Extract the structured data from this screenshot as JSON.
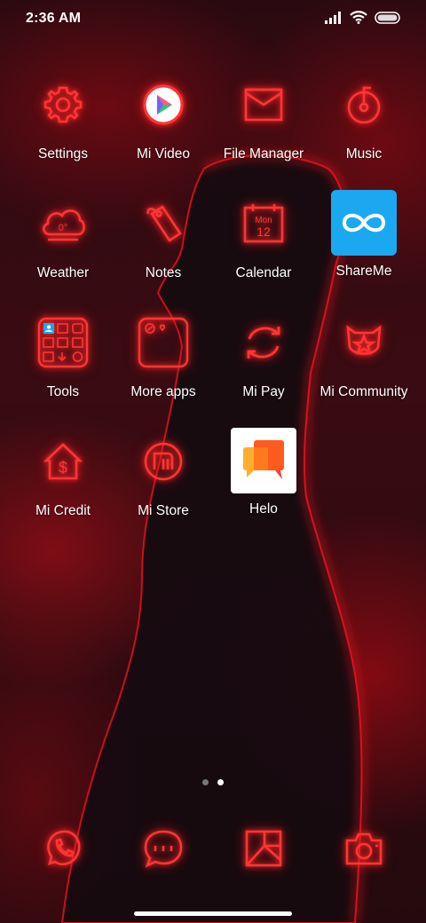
{
  "status": {
    "time": "2:36 AM",
    "icons": [
      "signal-icon",
      "wifi-icon",
      "battery-icon"
    ]
  },
  "apps": [
    {
      "label": "Settings",
      "icon": "gear-icon"
    },
    {
      "label": "Mi Video",
      "icon": "play-icon"
    },
    {
      "label": "File Manager",
      "icon": "folder-icon"
    },
    {
      "label": "Music",
      "icon": "music-icon"
    },
    {
      "label": "Weather",
      "icon": "cloud-icon",
      "badge": "0°"
    },
    {
      "label": "Notes",
      "icon": "tag-icon"
    },
    {
      "label": "Calendar",
      "icon": "calendar-icon",
      "month": "Mon",
      "day": "12"
    },
    {
      "label": "ShareMe",
      "icon": "infinity-icon"
    },
    {
      "label": "Tools",
      "icon": "tools-folder-icon"
    },
    {
      "label": "More apps",
      "icon": "more-apps-folder-icon"
    },
    {
      "label": "Mi Pay",
      "icon": "refresh-icon"
    },
    {
      "label": "Mi Community",
      "icon": "star-icon"
    },
    {
      "label": "Mi Credit",
      "icon": "dollar-house-icon"
    },
    {
      "label": "Mi Store",
      "icon": "mi-logo-icon"
    },
    {
      "label": "Helo",
      "icon": "chat-bubbles-icon"
    }
  ],
  "dock": [
    {
      "name": "phone",
      "icon": "phone-icon"
    },
    {
      "name": "messages",
      "icon": "message-icon"
    },
    {
      "name": "browser",
      "icon": "browser-icon"
    },
    {
      "name": "camera",
      "icon": "camera-icon"
    }
  ],
  "pages": {
    "count": 2,
    "active": 2
  },
  "colors": {
    "neon": "#ff2a2a",
    "shareme_bg": "#1aa9f0",
    "helo_orange": "#ff8a1f"
  }
}
